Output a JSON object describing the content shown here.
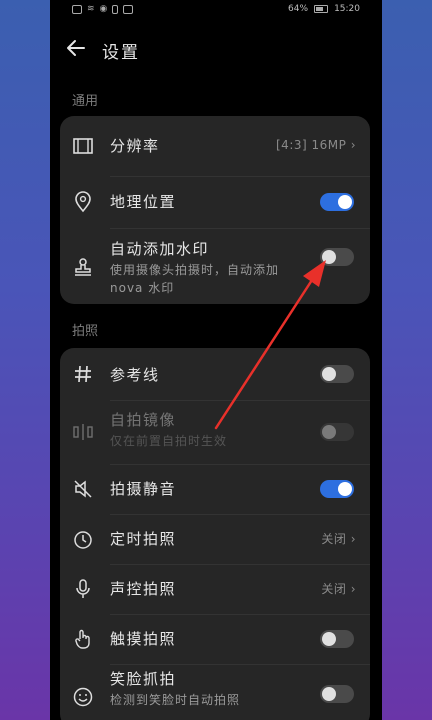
{
  "status": {
    "battery": "64%",
    "time": "15:20"
  },
  "header": {
    "title": "设置",
    "back_icon": "arrow-left-icon"
  },
  "sections": [
    {
      "label": "通用",
      "items": [
        {
          "label": "分辨率",
          "value": "[4:3] 16MP",
          "icon": "resolution-icon",
          "control": "chevron"
        },
        {
          "label": "地理位置",
          "icon": "location-pin-icon",
          "control": "toggle",
          "on": true
        },
        {
          "label": "自动添加水印",
          "sub": "使用摄像头拍摄时，自动添加 nova 水印",
          "icon": "stamp-icon",
          "control": "toggle",
          "on": false
        }
      ]
    },
    {
      "label": "拍照",
      "items": [
        {
          "label": "参考线",
          "icon": "hash-grid-icon",
          "control": "toggle",
          "on": false
        },
        {
          "label": "自拍镜像",
          "sub": "仅在前置自拍时生效",
          "icon": "mirror-icon",
          "control": "toggle",
          "on": false,
          "disabled": true
        },
        {
          "label": "拍摄静音",
          "icon": "mute-icon",
          "control": "toggle",
          "on": true
        },
        {
          "label": "定时拍照",
          "value": "关闭",
          "icon": "timer-icon",
          "control": "chevron"
        },
        {
          "label": "声控拍照",
          "value": "关闭",
          "icon": "microphone-icon",
          "control": "chevron"
        },
        {
          "label": "触摸拍照",
          "icon": "touch-hand-icon",
          "control": "toggle",
          "on": false
        },
        {
          "label": "笑脸抓拍",
          "sub": "检测到笑脸时自动拍照",
          "icon": "smile-icon",
          "control": "toggle",
          "on": false
        }
      ]
    }
  ],
  "annotation": {
    "color": "#e8302a"
  }
}
